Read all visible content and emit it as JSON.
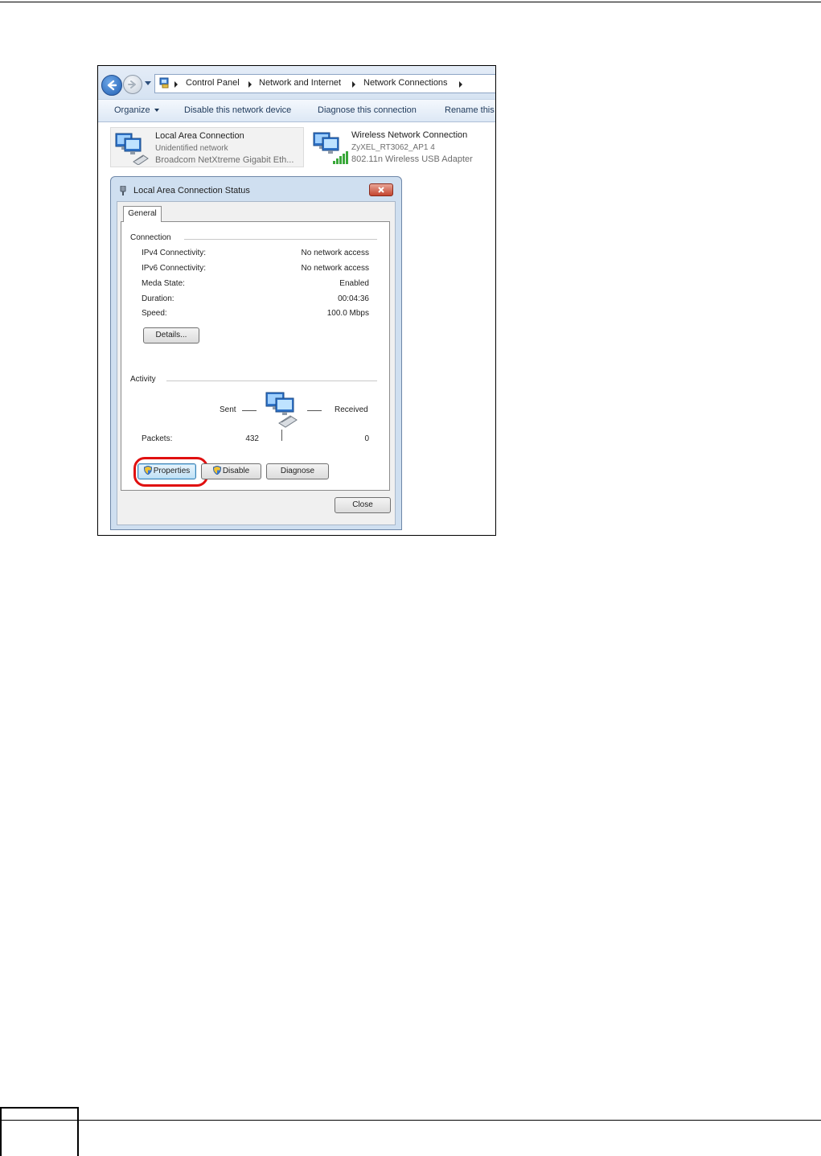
{
  "breadcrumb": {
    "items": [
      "Control Panel",
      "Network and Internet",
      "Network Connections"
    ]
  },
  "icons": {
    "back": "back-arrow-icon",
    "forward": "forward-arrow-icon",
    "control_panel": "control-panel-icon",
    "lan": "network-computers-icon",
    "wifi": "wireless-signal-icon",
    "shield": "uac-shield-icon",
    "close": "close-icon"
  },
  "toolbar": {
    "organize": "Organize",
    "disable_device": "Disable this network device",
    "diagnose": "Diagnose this connection",
    "rename": "Rename this"
  },
  "connections": [
    {
      "name": "Local Area Connection",
      "status": "Unidentified network",
      "adapter": "Broadcom NetXtreme Gigabit Eth..."
    },
    {
      "name": "Wireless Network Connection",
      "status": "ZyXEL_RT3062_AP1  4",
      "adapter": "802.11n Wireless USB Adapter"
    }
  ],
  "dialog": {
    "title": "Local Area Connection Status",
    "tab": "General",
    "connection_group": "Connection",
    "rows": [
      {
        "label": "IPv4 Connectivity:",
        "value": "No network access"
      },
      {
        "label": "IPv6 Connectivity:",
        "value": "No network access"
      },
      {
        "label": "Meda State:",
        "value": "Enabled"
      },
      {
        "label": "Duration:",
        "value": "00:04:36"
      },
      {
        "label": "Speed:",
        "value": "100.0 Mbps"
      }
    ],
    "details_button": "Details...",
    "activity_group": "Activity",
    "sent_label": "Sent",
    "received_label": "Received",
    "packets_label": "Packets:",
    "packets_sent": "432",
    "packets_received": "0",
    "properties_button": "Properties",
    "disable_button": "Disable",
    "diagnose_button": "Diagnose",
    "close_button": "Close"
  },
  "colors": {
    "highlight_ring": "#e01010",
    "title_bar": "#cfdff0",
    "signal_green": "#3aa83a"
  }
}
